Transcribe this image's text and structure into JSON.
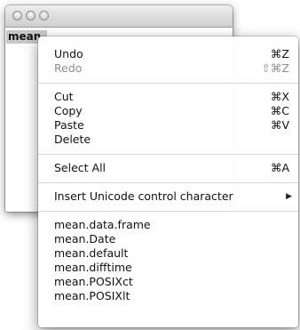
{
  "editor": {
    "text": "mean."
  },
  "menu": {
    "groups": [
      [
        {
          "label": "Undo",
          "shortcut": "⌘Z",
          "enabled": true
        },
        {
          "label": "Redo",
          "shortcut": "⇧⌘Z",
          "enabled": false
        }
      ],
      [
        {
          "label": "Cut",
          "shortcut": "⌘X",
          "enabled": true
        },
        {
          "label": "Copy",
          "shortcut": "⌘C",
          "enabled": true
        },
        {
          "label": "Paste",
          "shortcut": "⌘V",
          "enabled": true
        },
        {
          "label": "Delete",
          "shortcut": "",
          "enabled": true
        }
      ],
      [
        {
          "label": "Select All",
          "shortcut": "⌘A",
          "enabled": true
        }
      ],
      [
        {
          "label": "Insert Unicode control character",
          "submenu_arrow": "▶",
          "enabled": true
        }
      ],
      [
        {
          "label": "mean.data.frame"
        },
        {
          "label": "mean.Date"
        },
        {
          "label": "mean.default"
        },
        {
          "label": "mean.difftime"
        },
        {
          "label": "mean.POSIXct"
        },
        {
          "label": "mean.POSIXlt"
        }
      ]
    ]
  },
  "colors": {
    "disabled_text": "#8d8d8d",
    "selection_highlight": "#c7c7c7"
  },
  "icons": {
    "window_controls": [
      "close-button-icon",
      "minimize-button-icon",
      "zoom-button-icon"
    ],
    "submenu": "submenu-arrow-icon"
  }
}
